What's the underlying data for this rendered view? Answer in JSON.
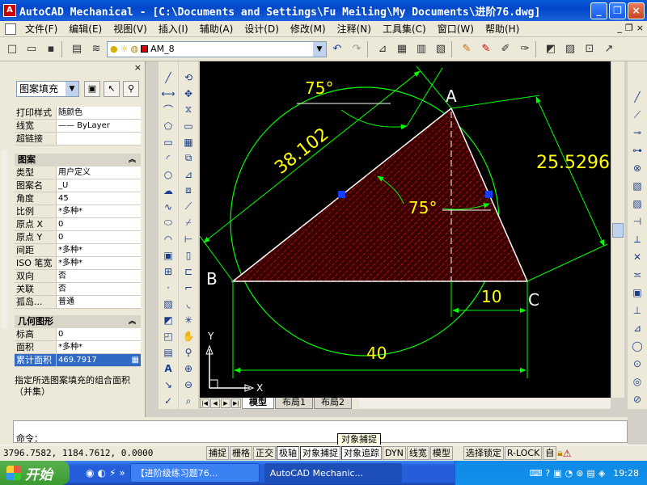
{
  "window": {
    "title": "AutoCAD Mechanical - [C:\\Documents and Settings\\Fu Meiling\\My Documents\\进阶76.dwg]",
    "app_icon": "A"
  },
  "window_buttons": {
    "minimize": "_",
    "maximize": "❐",
    "close": "×"
  },
  "menu": [
    "文件(F)",
    "编辑(E)",
    "视图(V)",
    "插入(I)",
    "辅助(A)",
    "设计(D)",
    "修改(M)",
    "注释(N)",
    "工具集(C)",
    "窗口(W)",
    "帮助(H)"
  ],
  "mdi_buttons": {
    "minimize": "_",
    "restore": "❐",
    "close": "×"
  },
  "toolbar": {
    "layer_name": "AM_8"
  },
  "properties": {
    "close": "×",
    "object_type": "图案填充",
    "general_rows": [
      {
        "key": "打印样式",
        "value": "随颜色"
      },
      {
        "key": "线宽",
        "value": "—— ByLayer"
      },
      {
        "key": "超链接",
        "value": ""
      }
    ],
    "pattern_header": "图案",
    "pattern_rows": [
      {
        "key": "类型",
        "value": "用户定义"
      },
      {
        "key": "图案名",
        "value": "_U"
      },
      {
        "key": "角度",
        "value": "45"
      },
      {
        "key": "比例",
        "value": "*多种*"
      },
      {
        "key": "原点 X",
        "value": "0"
      },
      {
        "key": "原点 Y",
        "value": "0"
      },
      {
        "key": "间距",
        "value": "*多种*"
      },
      {
        "key": "ISO 笔宽",
        "value": "*多种*"
      },
      {
        "key": "双向",
        "value": "否"
      },
      {
        "key": "关联",
        "value": "否"
      },
      {
        "key": "孤岛...",
        "value": "普通"
      }
    ],
    "geometry_header": "几何图形",
    "geometry_rows": [
      {
        "key": "标高",
        "value": "0"
      },
      {
        "key": "面积",
        "value": "*多种*"
      },
      {
        "key": "累计面积",
        "value": "469.7917"
      }
    ],
    "description": "指定所选图案填充的组合面积（并集）"
  },
  "drawing": {
    "labels": {
      "a": "A",
      "b": "B",
      "c": "C"
    },
    "dims": {
      "top_angle": "75°",
      "inner_angle": "75°",
      "side_ab": "38.102",
      "side_ac": "25.5296",
      "offset": "10",
      "base": "40"
    },
    "ucs": {
      "x": "X",
      "y": "Y"
    }
  },
  "layout_tabs": [
    "模型",
    "布局1",
    "布局2"
  ],
  "command_line": "命令：",
  "tooltip": "对象捕捉",
  "status": {
    "coords": "3796.7582, 1184.7612, 0.0000",
    "buttons": [
      "捕捉",
      "栅格",
      "正交",
      "极轴",
      "对象捕捉",
      "对象追踪",
      "DYN",
      "线宽",
      "模型"
    ],
    "right": [
      "选择锁定",
      "R-LOCK",
      "自"
    ]
  },
  "taskbar": {
    "start": "开始",
    "tasks": [
      "【进阶级练习题76...",
      "AutoCAD Mechanic..."
    ],
    "clock": "19:28"
  }
}
